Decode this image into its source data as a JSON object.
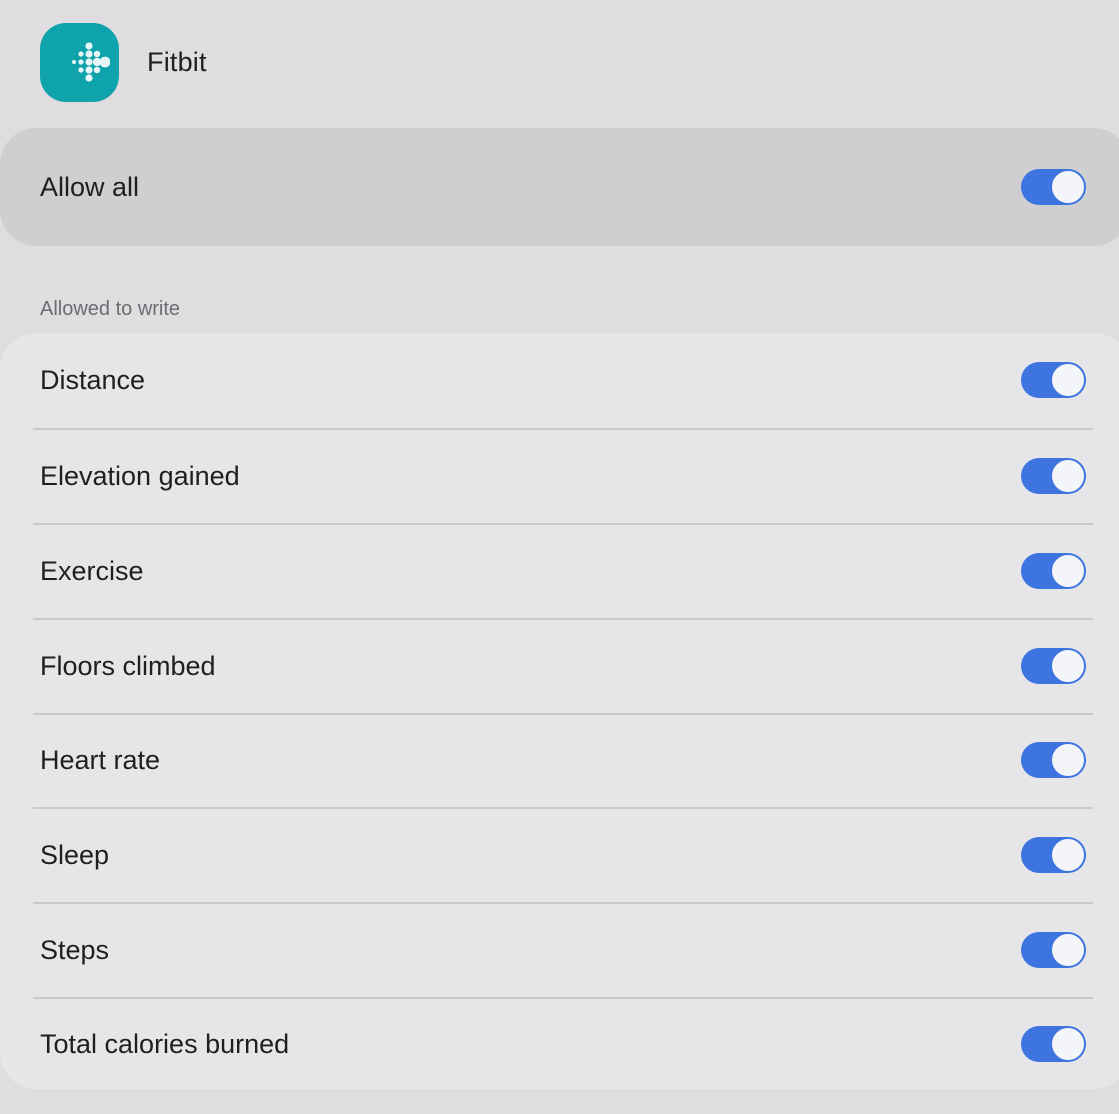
{
  "app": {
    "name": "Fitbit",
    "icon": "fitbit-logo-icon",
    "icon_color": "#0fa3ab"
  },
  "allow_all": {
    "label": "Allow all",
    "enabled": true
  },
  "section": {
    "title": "Allowed to write"
  },
  "permissions": [
    {
      "label": "Distance",
      "enabled": true
    },
    {
      "label": "Elevation gained",
      "enabled": true
    },
    {
      "label": "Exercise",
      "enabled": true
    },
    {
      "label": "Floors climbed",
      "enabled": true
    },
    {
      "label": "Heart rate",
      "enabled": true
    },
    {
      "label": "Sleep",
      "enabled": true
    },
    {
      "label": "Steps",
      "enabled": true
    },
    {
      "label": "Total calories burned",
      "enabled": true
    }
  ],
  "colors": {
    "toggle_on": "#3d74e0",
    "background": "#dfdde0"
  }
}
